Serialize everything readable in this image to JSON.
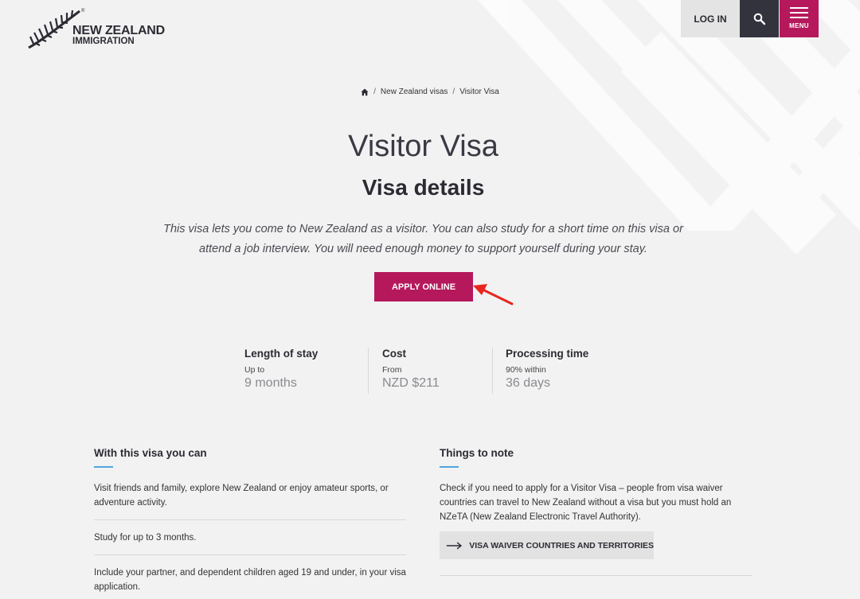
{
  "header": {
    "logo_line1": "NEW ZEALAND",
    "logo_line2": "IMMIGRATION",
    "logo_reg": "®",
    "login_label": "LOG IN",
    "menu_label": "MENU"
  },
  "breadcrumb": {
    "items": [
      "New Zealand visas",
      "Visitor Visa"
    ],
    "separator": "/"
  },
  "page": {
    "title": "Visitor Visa",
    "section_title": "Visa details",
    "intro": "This visa lets you come to New Zealand as a visitor. You can also study for a short time on this visa or attend a job interview. You will need enough money to support yourself during your stay.",
    "apply_label": "APPLY ONLINE"
  },
  "stats": [
    {
      "label": "Length of stay",
      "sub": "Up to",
      "value": "9 months"
    },
    {
      "label": "Cost",
      "sub": "From",
      "value": "NZD $211"
    },
    {
      "label": "Processing time",
      "sub": "90% within",
      "value": "36 days"
    }
  ],
  "can": {
    "title": "With this visa you can",
    "items": [
      "Visit friends and family, explore New Zealand or enjoy amateur sports, or adventure activity.",
      "Study for up to 3 months.",
      "Include your partner, and dependent children aged 19 and under, in your visa application."
    ]
  },
  "notes": {
    "title": "Things to note",
    "text": "Check if you need to apply for a Visitor Visa – people from visa waiver countries can travel to New Zealand without a visa but you must hold an NZeTA (New Zealand Electronic Travel Authority).",
    "button_label": "VISA WAIVER COUNTRIES AND TERRITORIES"
  },
  "colors": {
    "brand": "#b5195c",
    "dark": "#33333d",
    "accent": "#4ea6dc",
    "annotation": "#e8261f"
  },
  "icons": [
    "fern-logo-icon",
    "search-icon",
    "menu-icon",
    "home-icon",
    "arrow-right-icon",
    "annotation-arrow-icon"
  ]
}
